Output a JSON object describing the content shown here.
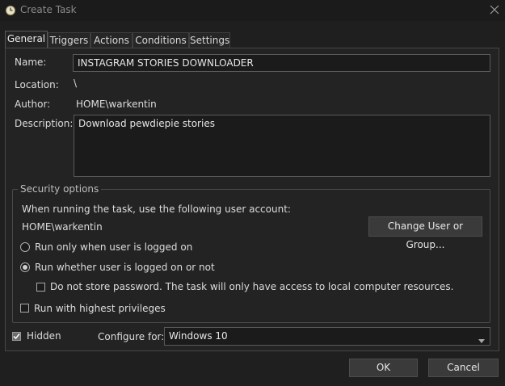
{
  "window": {
    "title": "Create Task"
  },
  "tabs": [
    {
      "label": "General",
      "active": true
    },
    {
      "label": "Triggers",
      "active": false
    },
    {
      "label": "Actions",
      "active": false
    },
    {
      "label": "Conditions",
      "active": false
    },
    {
      "label": "Settings",
      "active": false
    }
  ],
  "general": {
    "name_label": "Name:",
    "name_value": "INSTAGRAM STORIES DOWNLOADER",
    "location_label": "Location:",
    "location_value": "\\",
    "author_label": "Author:",
    "author_value": "HOME\\warkentin",
    "description_label": "Description:",
    "description_value": "Download pewdiepie stories"
  },
  "security": {
    "legend": "Security options",
    "account_prompt": "When running the task, use the following user account:",
    "account_value": "HOME\\warkentin",
    "change_button": "Change User or Group...",
    "radio_logged_on": {
      "label": "Run only when user is logged on",
      "checked": false
    },
    "radio_whether": {
      "label": "Run whether user is logged on or not",
      "checked": true
    },
    "no_store_password": {
      "label": "Do not store password.  The task will only have access to local computer resources.",
      "checked": false
    },
    "highest_privileges": {
      "label": "Run with highest privileges",
      "checked": false
    }
  },
  "bottom": {
    "hidden": {
      "label": "Hidden",
      "checked": true
    },
    "configure_label": "Configure for:",
    "configure_value": "Windows 10"
  },
  "buttons": {
    "ok": "OK",
    "cancel": "Cancel"
  },
  "colors": {
    "window_bg": "#1f1f1f",
    "panel_bg": "#232323",
    "field_bg": "#1b1b1b",
    "button_bg": "#3a3a3a"
  }
}
